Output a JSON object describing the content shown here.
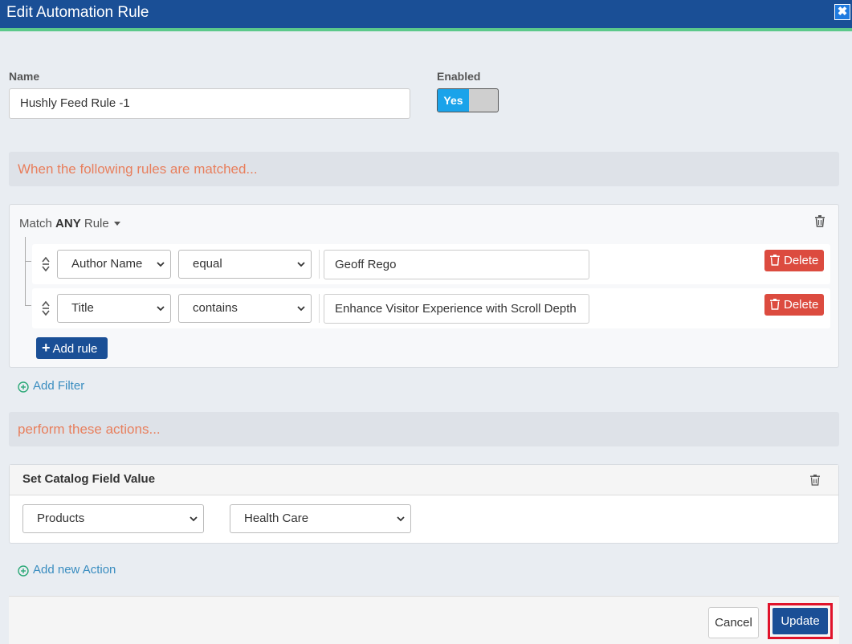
{
  "window": {
    "title": "Edit Automation Rule",
    "close_symbol": "✖"
  },
  "form": {
    "name_label": "Name",
    "name_value": "Hushly Feed Rule -1",
    "enabled_label": "Enabled",
    "enabled_toggle": "Yes"
  },
  "rules_section": {
    "heading": "When the following rules are matched...",
    "match_prefix": "Match",
    "match_mode": "ANY",
    "match_suffix": "Rule",
    "rows": [
      {
        "field": "Author Name",
        "operator": "equal",
        "value": "Geoff Rego",
        "delete_label": "Delete"
      },
      {
        "field": "Title",
        "operator": "contains",
        "value": "Enhance Visitor Experience with Scroll Depth",
        "delete_label": "Delete"
      }
    ],
    "add_rule_label": "Add rule",
    "add_filter_label": "Add Filter"
  },
  "actions_section": {
    "heading": "perform these actions...",
    "action_title": "Set Catalog Field Value",
    "field_select": "Products",
    "value_select": "Health Care",
    "add_action_label": "Add new Action"
  },
  "footer": {
    "cancel_label": "Cancel",
    "update_label": "Update"
  },
  "colors": {
    "title_bar": "#1a4f96",
    "accent_green": "#5cc98b",
    "section_heading_text": "#e87f5d",
    "toggle_on": "#1aa3ea",
    "delete_button": "#dc4b3f",
    "primary_button": "#1a4f96",
    "highlight_border": "#e0132a",
    "link": "#3a8dc0"
  }
}
